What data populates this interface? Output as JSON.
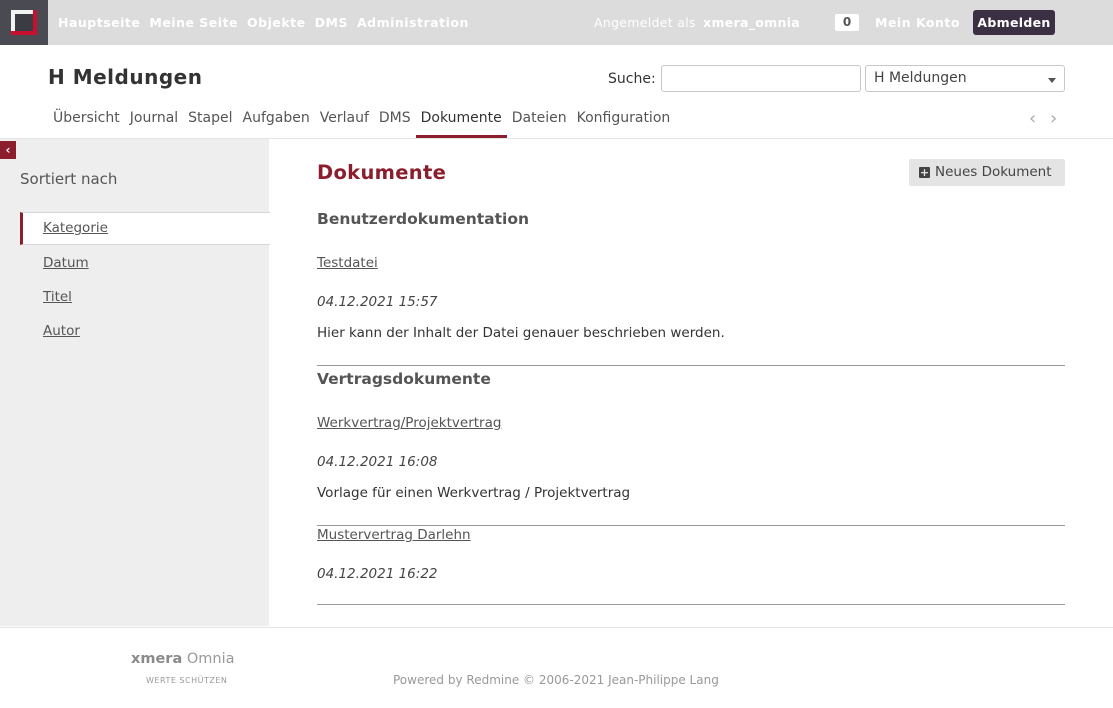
{
  "topbar": {
    "menu": [
      "Hauptseite",
      "Meine Seite",
      "Objekte",
      "DMS",
      "Administration"
    ],
    "logged_as_label": "Angemeldet als",
    "username": "xmera_omnia",
    "counter": "0",
    "my_account": "Mein Konto",
    "logout": "Abmelden"
  },
  "header": {
    "project_title": "H Meldungen",
    "search_label": "Suche:",
    "search_value": "",
    "project_select": "H Meldungen"
  },
  "tabs": [
    {
      "label": "Übersicht",
      "active": false
    },
    {
      "label": "Journal",
      "active": false
    },
    {
      "label": "Stapel",
      "active": false
    },
    {
      "label": "Aufgaben",
      "active": false
    },
    {
      "label": "Verlauf",
      "active": false
    },
    {
      "label": "DMS",
      "active": false
    },
    {
      "label": "Dokumente",
      "active": true
    },
    {
      "label": "Dateien",
      "active": false
    },
    {
      "label": "Konfiguration",
      "active": false
    }
  ],
  "tab_nav": {
    "prev": "‹",
    "next": "›"
  },
  "sidebar": {
    "toggle": "‹",
    "heading": "Sortiert nach",
    "sort_options": [
      "Kategorie",
      "Datum",
      "Titel",
      "Autor"
    ],
    "selected": "Kategorie"
  },
  "main": {
    "title": "Dokumente",
    "new_document": "Neues Dokument",
    "categories": [
      {
        "name": "Benutzerdokumentation",
        "documents": [
          {
            "title": "Testdatei",
            "date": "04.12.2021 15:57",
            "description": "Hier kann der Inhalt der Datei genauer beschrieben werden."
          }
        ]
      },
      {
        "name": "Vertragsdokumente",
        "documents": [
          {
            "title": "Werkvertrag/Projektvertrag",
            "date": "04.12.2021 16:08",
            "description": "Vorlage für einen Werkvertrag / Projektvertrag"
          },
          {
            "title": "Mustervertrag Darlehn",
            "date": "04.12.2021 16:22",
            "description": ""
          }
        ]
      }
    ]
  },
  "footer": {
    "brand_bold": "xmera",
    "brand_rest": "Omnia",
    "tagline": "WERTE SCHÜTZEN",
    "powered_prefix": "Powered by",
    "powered_link": "Redmine",
    "powered_suffix": "© 2006-2021 Jean-Philippe Lang"
  },
  "colors": {
    "accent": "#8b1d2c",
    "topbar": "#dcdcdc",
    "logout_bg": "#3b2f44"
  }
}
